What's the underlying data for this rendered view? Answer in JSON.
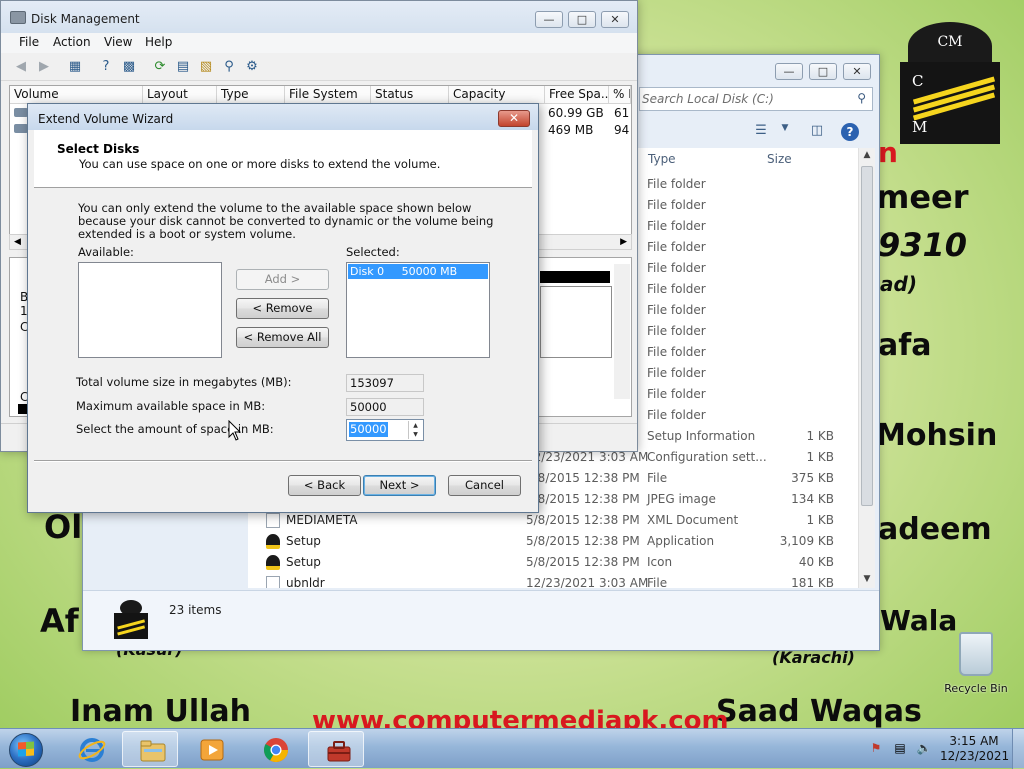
{
  "wallpaper": {
    "names": [
      "n",
      "meer",
      "9310",
      "ad)",
      "afa",
      "Mohsin",
      "adeem",
      "Wala",
      "(Karachi)",
      "Saad Waqas",
      "Inam Ullah",
      "Ol",
      "Af",
      "(Kasur)"
    ],
    "website": "www.computermediapk.com",
    "logo_letters": [
      "CM",
      "C",
      "M"
    ]
  },
  "recycle_bin": {
    "label": "Recycle Bin"
  },
  "explorer": {
    "search_placeholder": "Search Local Disk (C:)",
    "columns": {
      "type": "Type",
      "size": "Size"
    },
    "rows": [
      {
        "name": "",
        "date": "",
        "type": "File folder",
        "size": ""
      },
      {
        "name": "",
        "date": "",
        "type": "File folder",
        "size": ""
      },
      {
        "name": "",
        "date": "",
        "type": "File folder",
        "size": ""
      },
      {
        "name": "",
        "date": "",
        "type": "File folder",
        "size": ""
      },
      {
        "name": "",
        "date": "",
        "type": "File folder",
        "size": ""
      },
      {
        "name": "",
        "date": "",
        "type": "File folder",
        "size": ""
      },
      {
        "name": "",
        "date": "",
        "type": "File folder",
        "size": ""
      },
      {
        "name": "",
        "date": "",
        "type": "File folder",
        "size": ""
      },
      {
        "name": "",
        "date": "",
        "type": "File folder",
        "size": ""
      },
      {
        "name": "",
        "date": "",
        "type": "File folder",
        "size": ""
      },
      {
        "name": "",
        "date": "",
        "type": "File folder",
        "size": ""
      },
      {
        "name": "",
        "date": "",
        "type": "File folder",
        "size": ""
      },
      {
        "name": "",
        "date": "",
        "type": "Setup Information",
        "size": "1 KB"
      },
      {
        "name": "",
        "date": "12/23/2021 3:03 AM",
        "type": "Configuration sett...",
        "size": "1 KB"
      },
      {
        "name": "",
        "date": "5/8/2015 12:38 PM",
        "type": "File",
        "size": "375 KB"
      },
      {
        "name": "",
        "date": "5/8/2015 12:38 PM",
        "type": "JPEG image",
        "size": "134 KB"
      },
      {
        "name": "MEDIAMETA",
        "date": "5/8/2015 12:38 PM",
        "type": "XML Document",
        "size": "1 KB"
      },
      {
        "name": "Setup",
        "date": "5/8/2015 12:38 PM",
        "type": "Application",
        "size": "3,109 KB"
      },
      {
        "name": "Setup",
        "date": "5/8/2015 12:38 PM",
        "type": "Icon",
        "size": "40 KB"
      },
      {
        "name": "ubnldr",
        "date": "12/23/2021 3:03 AM",
        "type": "File",
        "size": "181 KB"
      }
    ],
    "item_count": "23 items"
  },
  "disk_management": {
    "title": "Disk Management",
    "menu": [
      "File",
      "Action",
      "View",
      "Help"
    ],
    "columns": [
      "Volume",
      "Layout",
      "Type",
      "File System",
      "Status",
      "Capacity",
      "Free Spa...",
      "% F"
    ],
    "rows": [
      {
        "free": "60.99 GB",
        "pct": "61"
      },
      {
        "free": "469 MB",
        "pct": "94"
      }
    ],
    "graph_labels": [
      "B",
      "1",
      "C",
      "C"
    ]
  },
  "wizard": {
    "title": "Extend Volume Wizard",
    "heading": "Select Disks",
    "subheading": "You can use space on one or more disks to extend the volume.",
    "description": "You can only extend the volume to the available space shown below because your disk cannot be converted to dynamic or the volume being extended is a boot or system volume.",
    "available_label": "Available:",
    "selected_label": "Selected:",
    "selected_items": [
      "Disk 0     50000 MB"
    ],
    "add_button": "Add >",
    "remove_button": "< Remove",
    "remove_all_button": "< Remove All",
    "total_label": "Total volume size in megabytes (MB):",
    "total_value": "153097",
    "max_label": "Maximum available space in MB:",
    "max_value": "50000",
    "amount_label": "Select the amount of space in MB:",
    "amount_value": "50000",
    "back_button": "< Back",
    "next_button": "Next >",
    "cancel_button": "Cancel"
  },
  "taskbar": {
    "time": "3:15 AM",
    "date": "12/23/2021"
  }
}
